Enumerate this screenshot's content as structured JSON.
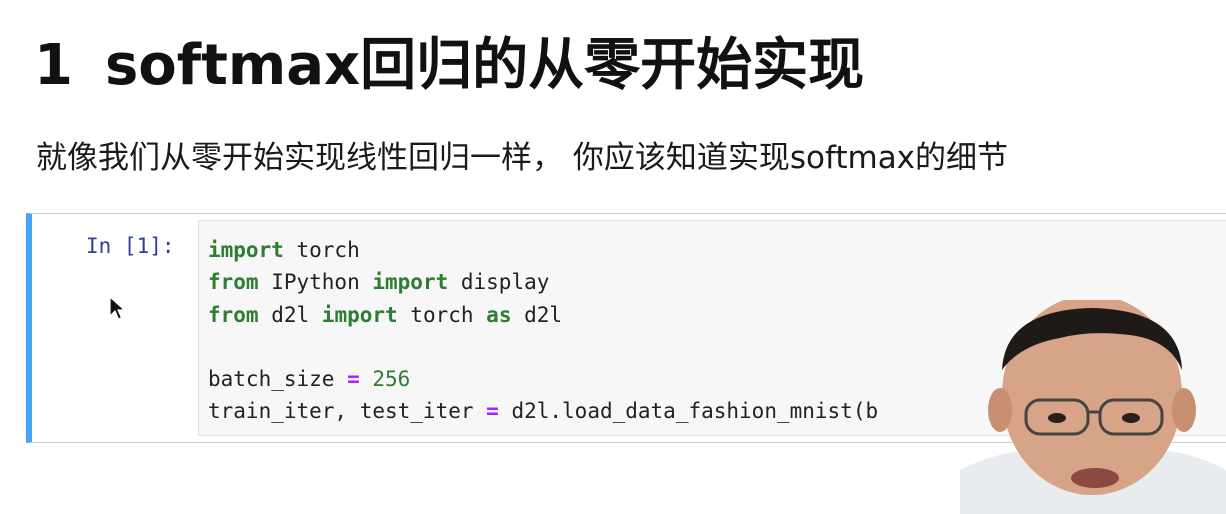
{
  "heading": {
    "number": "1",
    "text": "softmax回归的从零开始实现"
  },
  "subtitle": "就像我们从零开始实现线性回归一样， 你应该知道实现softmax的细节",
  "cell": {
    "prompt": "In [1]:",
    "code": {
      "l1_kw": "import",
      "l1_rest": " torch",
      "l2_kw1": "from",
      "l2_mid": " IPython ",
      "l2_kw2": "import",
      "l2_rest": " display",
      "l3_kw1": "from",
      "l3_mid": " d2l ",
      "l3_kw2": "import",
      "l3_mid2": " torch ",
      "l3_kw3": "as",
      "l3_rest": " d2l",
      "l5_lhs": "batch_size ",
      "l5_op": "=",
      "l5_num": " 256",
      "l6_lhs": "train_iter, test_iter ",
      "l6_op": "=",
      "l6_rest": " d2l.load_data_fashion_mnist(b"
    }
  },
  "colors": {
    "keyword": "#2e7d32",
    "operator": "#aa22ff",
    "prompt": "#303f9f",
    "cell_border_active": "#42a5f5"
  },
  "icons": {
    "cursor": "mouse-pointer-icon",
    "presenter": "presenter-webcam-overlay"
  }
}
